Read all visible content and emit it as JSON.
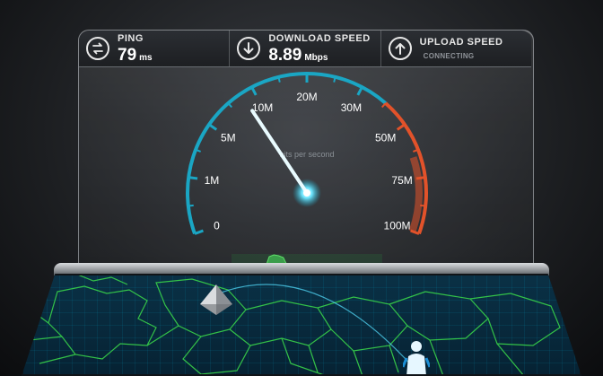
{
  "stats": {
    "ping": {
      "label": "PING",
      "value": "79",
      "unit": "ms",
      "icon": "ping-arrows-icon"
    },
    "download": {
      "label": "DOWNLOAD SPEED",
      "value": "8.89",
      "unit": "Mbps",
      "icon": "download-arrow-icon"
    },
    "upload": {
      "label": "UPLOAD SPEED",
      "status": "CONNECTING",
      "icon": "upload-arrow-icon"
    }
  },
  "gauge": {
    "unit_label": "bits per second",
    "ticks": [
      "0",
      "1M",
      "5M",
      "10M",
      "20M",
      "30M",
      "50M",
      "75M",
      "100M"
    ],
    "needle_value": "8.89",
    "colors": {
      "arc": "#1aa6c4",
      "hot_arc": "#e2522a",
      "needle": "#e9fbff"
    }
  },
  "map": {
    "colors": {
      "borders": "#39d34a",
      "grid": "#0e6f8a",
      "water": "#0a3146"
    },
    "server_icon": "server-pyramid-icon",
    "user_icon": "user-person-icon"
  }
}
